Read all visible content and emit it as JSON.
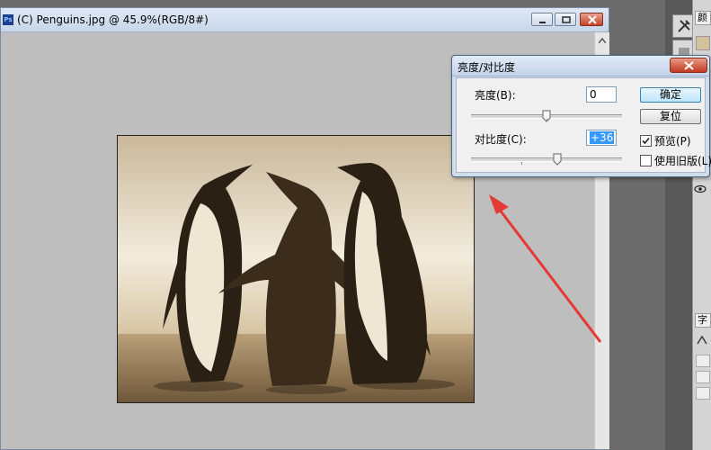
{
  "document": {
    "app_icon_text": "Ps",
    "title": "(C) Penguins.jpg @ 45.9%(RGB/8#)"
  },
  "dialog": {
    "title": "亮度/对比度",
    "brightness_label": "亮度(B):",
    "brightness_value": "0",
    "contrast_label": "对比度(C):",
    "contrast_value": "+36",
    "brightness_slider": {
      "min": -150,
      "max": 150,
      "value": 0
    },
    "contrast_slider": {
      "min": -50,
      "max": 100,
      "value": 36
    },
    "ok_label": "确定",
    "reset_label": "复位",
    "preview_label": "预览(P)",
    "preview_checked": true,
    "legacy_label": "使用旧版(L)",
    "legacy_checked": false
  },
  "dock": {
    "tab_top": "颜",
    "tab_char": "字"
  },
  "colors": {
    "arrow": "#e53935",
    "sepia_dark": "#2b2014",
    "sepia_light": "#efe6d3"
  }
}
